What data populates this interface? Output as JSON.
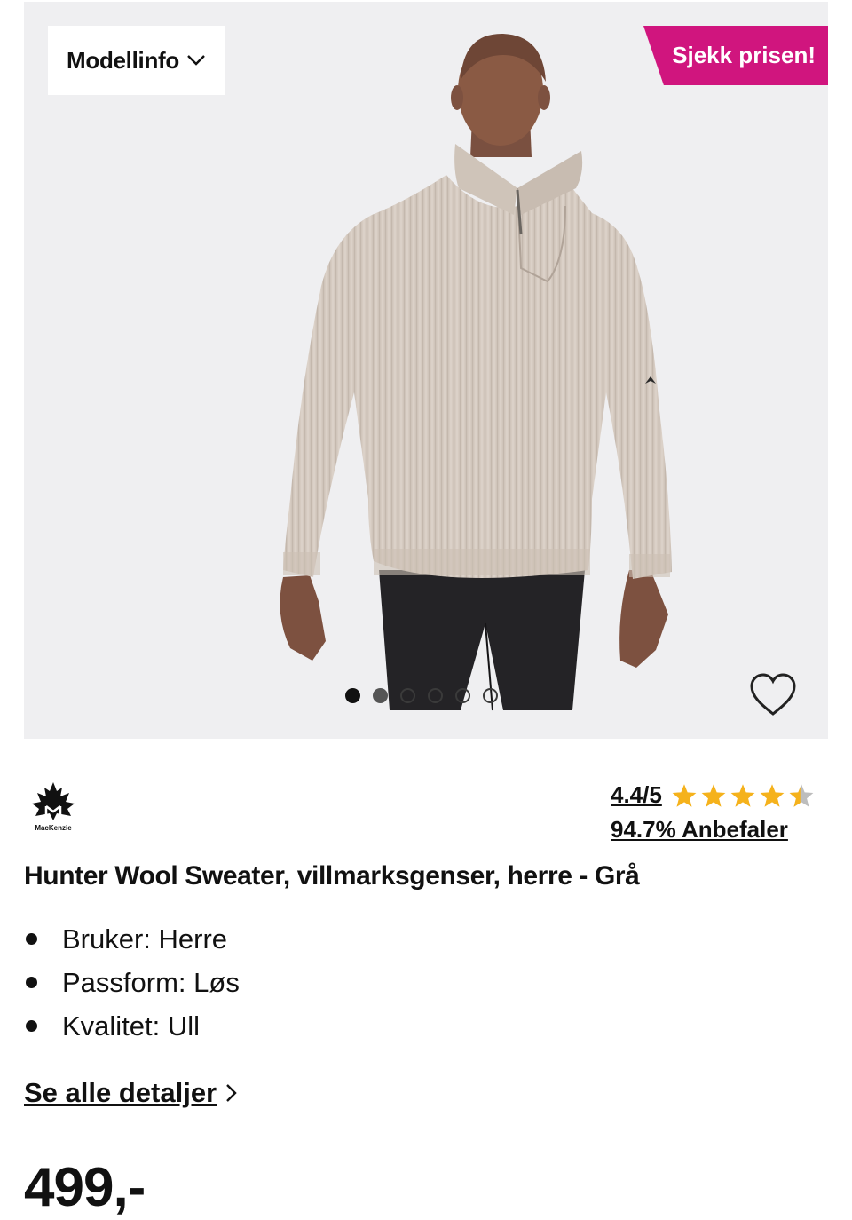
{
  "gallery": {
    "model_info_label": "Modellinfo",
    "price_badge": "Sjekk prisen!",
    "badge_color": "#d0157e",
    "image_count": 6,
    "active_image": 1,
    "favorite_icon": "heart-icon"
  },
  "brand": {
    "name": "MacKenzie",
    "logo_icon": "maple-leaf-logo"
  },
  "rating": {
    "score": "4.4/5",
    "value": 4.4,
    "max": 5,
    "recommend": "94.7% Anbefaler",
    "star_color": "#f5b21c"
  },
  "product": {
    "title": "Hunter Wool Sweater, villmarksgenser, herre - Grå",
    "specs": [
      "Bruker: Herre",
      "Passform: Løs",
      "Kvalitet: Ull"
    ],
    "details_link": "Se alle detaljer",
    "price": "499,-"
  }
}
